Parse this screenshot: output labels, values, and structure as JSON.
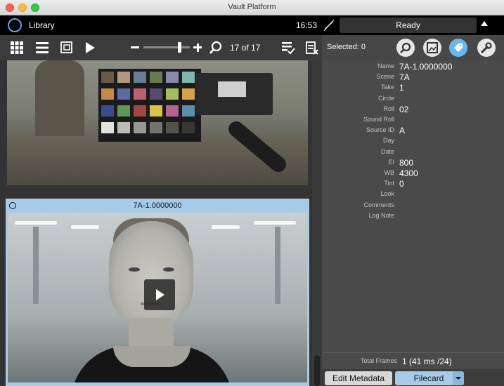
{
  "window": {
    "title": "Vault Platform"
  },
  "header": {
    "section": "Library",
    "clock": "16:53",
    "status": "Ready"
  },
  "toolbar": {
    "clip_count": "17 of 17",
    "selected": "Selected: 0",
    "left_icons": [
      "grid-view-icon",
      "list-view-icon",
      "filmstrip-view-icon",
      "play-icon",
      "zoom-out-icon",
      "zoom-slider",
      "zoom-in-icon",
      "search-icon",
      "apply-metadata-icon",
      "clear-metadata-icon"
    ],
    "right_icons": [
      "inspect-icon",
      "image-icon",
      "tag-icon",
      "wrench-icon"
    ],
    "zoom_level": 0.8
  },
  "clips": [
    {
      "name": ""
    },
    {
      "name": "7A-1.0000000",
      "selected": true
    }
  ],
  "metadata": {
    "fields": [
      {
        "key": "Name",
        "value": "7A-1.0000000"
      },
      {
        "key": "Scene",
        "value": "7A"
      },
      {
        "key": "Take",
        "value": "1"
      },
      {
        "key": "Circle",
        "value": ""
      },
      {
        "key": "Roll",
        "value": "02"
      },
      {
        "key": "Sound Roll",
        "value": ""
      },
      {
        "key": "Source ID",
        "value": "A"
      },
      {
        "key": "Day",
        "value": ""
      },
      {
        "key": "Date",
        "value": ""
      },
      {
        "key": "EI",
        "value": "800"
      },
      {
        "key": "WB",
        "value": "4300"
      },
      {
        "key": "Tint",
        "value": "0"
      },
      {
        "key": "Look",
        "value": ""
      },
      {
        "key": "Comments",
        "value": ""
      },
      {
        "key": "Log Note",
        "value": ""
      }
    ],
    "total_frames_label": "Total Frames",
    "total_frames_value": "1 (41 ms /24)"
  },
  "buttons": {
    "edit_metadata": "Edit Metadata",
    "filecard": "Filecard"
  },
  "colors": {
    "accent": "#6ab7ee",
    "selection": "#a6cbe8",
    "toolbar": "#3b3b3b",
    "panel": "#4a4a4a"
  }
}
